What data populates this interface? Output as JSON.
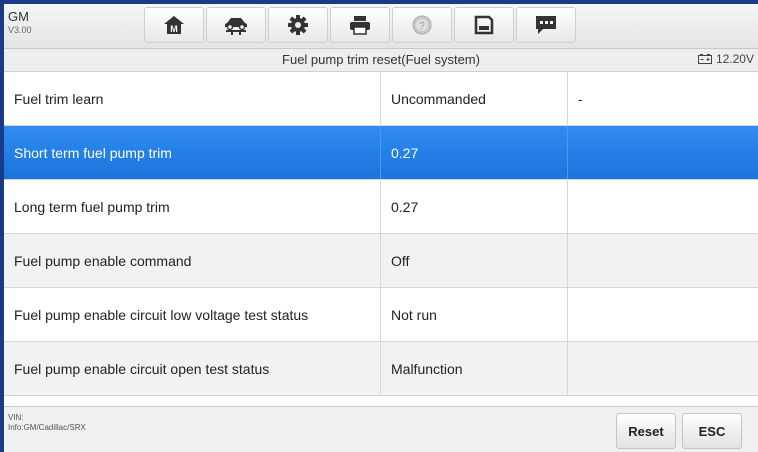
{
  "header": {
    "brand": "GM",
    "version": "V3.00",
    "toolbar": [
      {
        "icon": "home-icon"
      },
      {
        "icon": "vehicle-lift-icon"
      },
      {
        "icon": "gear-icon"
      },
      {
        "icon": "printer-icon"
      },
      {
        "icon": "help-icon"
      },
      {
        "icon": "save-icon"
      },
      {
        "icon": "message-icon"
      }
    ]
  },
  "title": "Fuel pump trim reset(Fuel system)",
  "battery": "12.20V",
  "rows": [
    {
      "name": "Fuel trim learn",
      "value": "Uncommanded",
      "unit": "-"
    },
    {
      "name": "Short term fuel pump trim",
      "value": "0.27",
      "unit": ""
    },
    {
      "name": "Long term fuel pump trim",
      "value": "0.27",
      "unit": ""
    },
    {
      "name": "Fuel pump enable command",
      "value": "Off",
      "unit": ""
    },
    {
      "name": "Fuel pump enable circuit low voltage test status",
      "value": "Not run",
      "unit": ""
    },
    {
      "name": "Fuel pump enable circuit open test status",
      "value": "Malfunction",
      "unit": ""
    }
  ],
  "footer": {
    "vin": "VIN:",
    "info": "Info:GM/Cadillac/SRX",
    "reset_label": "Reset",
    "esc_label": "ESC"
  },
  "colors": {
    "selected_row": "#1f7ee6",
    "frame_border": "#1a3a8a"
  }
}
